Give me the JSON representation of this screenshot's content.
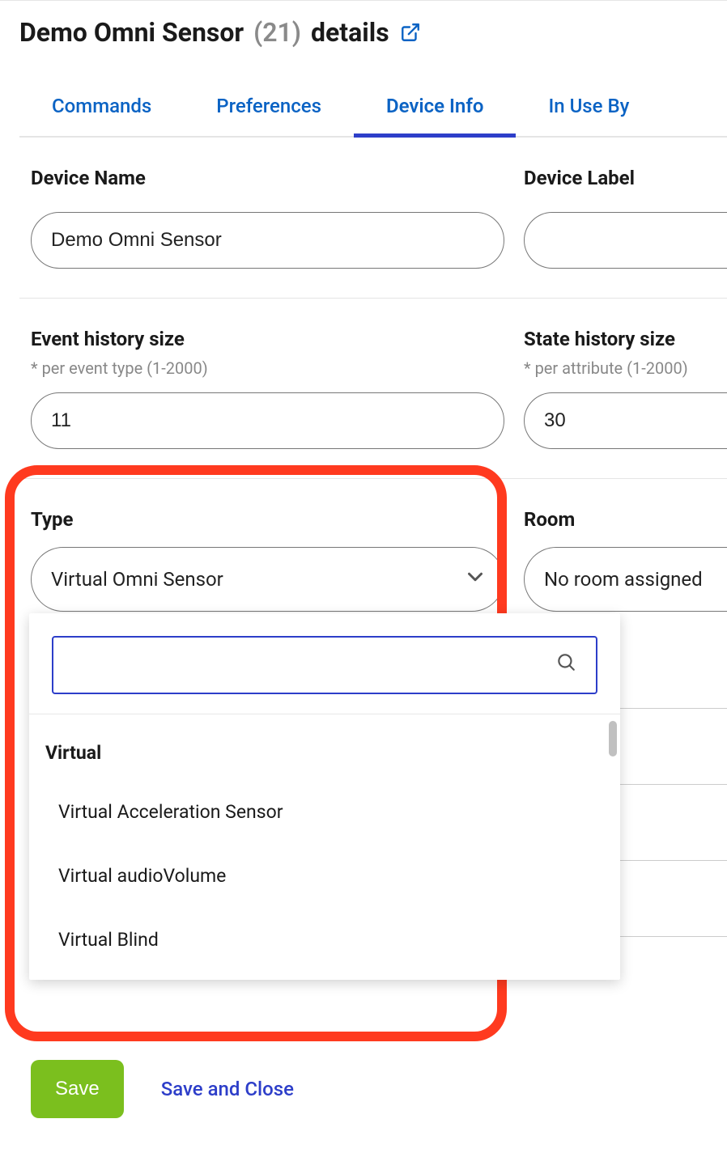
{
  "header": {
    "device_title": "Demo Omni Sensor",
    "device_count": "(21)",
    "title_suffix": "details"
  },
  "tabs": {
    "commands": "Commands",
    "preferences": "Preferences",
    "device_info": "Device Info",
    "in_use_by": "In Use By"
  },
  "form": {
    "device_name": {
      "label": "Device Name",
      "value": "Demo Omni Sensor"
    },
    "device_label": {
      "label": "Device Label",
      "value": ""
    },
    "event_history": {
      "label": "Event history size",
      "sublabel": "* per event type (1-2000)",
      "value": "11"
    },
    "state_history": {
      "label": "State history size",
      "sublabel": "* per attribute (1-2000)",
      "value": "30"
    },
    "type": {
      "label": "Type",
      "selected": "Virtual Omni Sensor",
      "dropdown": {
        "group_header": "Virtual",
        "options": [
          "Virtual Acceleration Sensor",
          "Virtual audioVolume",
          "Virtual Blind"
        ]
      }
    },
    "room": {
      "label": "Room",
      "selected": "No room assigned"
    }
  },
  "footer": {
    "save": "Save",
    "save_close": "Save and Close"
  }
}
